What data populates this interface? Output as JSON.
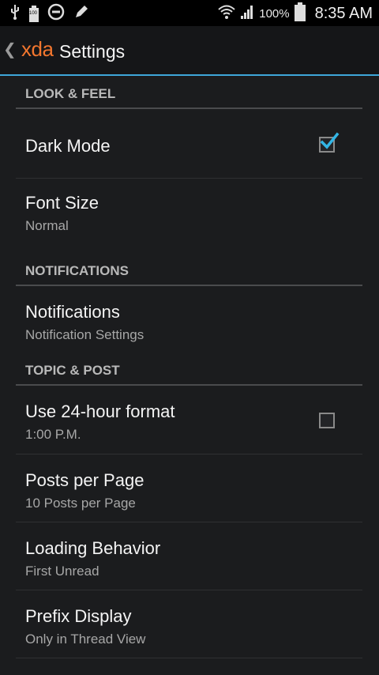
{
  "status_bar": {
    "battery_small_label": "100",
    "battery_percent": "100%",
    "time": "8:35 AM",
    "icons": [
      "usb-icon",
      "battery-icon",
      "do-not-disturb-icon",
      "edit-icon",
      "wifi-icon",
      "signal-icon",
      "battery-full-icon"
    ]
  },
  "action_bar": {
    "brand": "xda",
    "title": "Settings",
    "accent_color": "#3ea6d9",
    "brand_color": "#f2762e"
  },
  "sections": {
    "look_feel": {
      "header": "LOOK & FEEL",
      "dark_mode": {
        "title": "Dark Mode",
        "checked": true
      },
      "font_size": {
        "title": "Font Size",
        "summary": "Normal"
      }
    },
    "notifications": {
      "header": "NOTIFICATIONS",
      "notifications": {
        "title": "Notifications",
        "summary": "Notification Settings"
      }
    },
    "topic_post": {
      "header": "TOPIC & POST",
      "time_format": {
        "title": "Use 24-hour format",
        "summary": "1:00 P.M.",
        "checked": false
      },
      "posts_per_page": {
        "title": "Posts per Page",
        "summary": "10 Posts per Page"
      },
      "loading_behavior": {
        "title": "Loading Behavior",
        "summary": "First Unread"
      },
      "prefix_display": {
        "title": "Prefix Display",
        "summary": "Only in Thread View"
      }
    }
  }
}
